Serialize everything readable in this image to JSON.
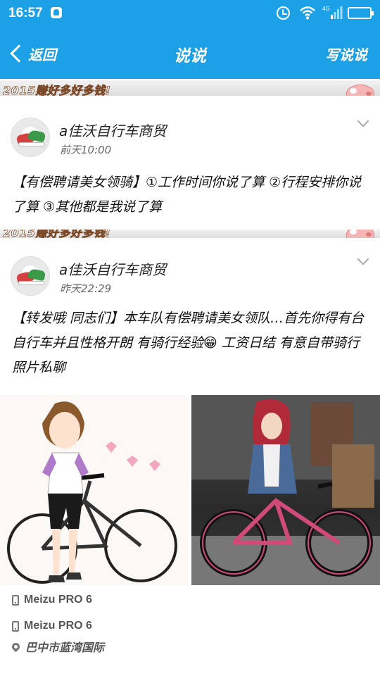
{
  "status_bar": {
    "time": "16:57",
    "network_label": "4G",
    "icons": [
      "notification-icon",
      "alarm-icon",
      "wifi-icon",
      "signal-icon",
      "battery-icon"
    ]
  },
  "nav": {
    "back_label": "返回",
    "title": "说说",
    "write_label": "写说说"
  },
  "banner": {
    "text": "2015赚好多好多钱!"
  },
  "posts": [
    {
      "user_name": "a佳沃自行车商贸",
      "time": "前天10:00",
      "text": "【有偿聘请美女领骑】①工作时间你说了算 ②行程安排你说了算 ③其他都是我说了算"
    },
    {
      "user_name": "a佳沃自行车商贸",
      "time": "昨天22:29",
      "text": "【转发哦 同志们】本车队有偿聘请美女领队…首先你得有台自行车并且性格开朗 有骑行经验😁 工资日结 有意自带骑行照片私聊",
      "photos": [
        "illustration-cyclist-girl",
        "photo-girl-with-bike"
      ]
    }
  ],
  "footer": {
    "device_1": "Meizu PRO 6",
    "device_2": "Meizu PRO 6",
    "location": "巴中市蓝湾国际"
  },
  "colors": {
    "accent": "#1da1e6",
    "text": "#111111",
    "meta": "#666666"
  }
}
